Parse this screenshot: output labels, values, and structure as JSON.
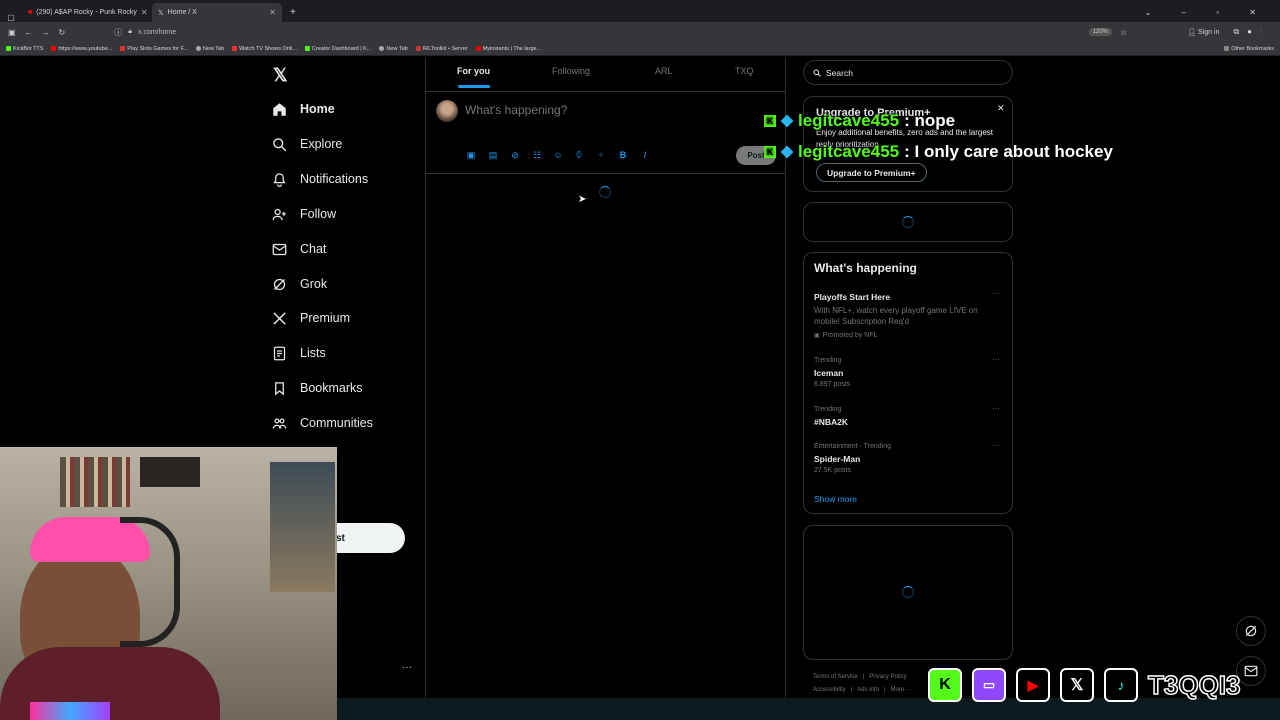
{
  "browser": {
    "tabs": [
      {
        "label": "(290) A$AP Rocky - Punk Rocky"
      },
      {
        "label": "Home / X"
      }
    ],
    "url": "x.com/home",
    "zoom": "120%",
    "sign_in": "Sign in",
    "bookmarks": [
      "KickBot TTS",
      "https://www.youtube...",
      "Play Slots Games for F...",
      "New Tab",
      "Watch TV Shows Onli...",
      "Creator Dashboard | K...",
      "New Tab",
      "IRLToolkit • Server",
      "Myinstants | The large..."
    ],
    "other_bookmarks": "Other Bookmarks"
  },
  "nav": {
    "items": [
      {
        "label": "Home",
        "icon": "home-icon"
      },
      {
        "label": "Explore",
        "icon": "search-icon"
      },
      {
        "label": "Notifications",
        "icon": "bell-icon"
      },
      {
        "label": "Follow",
        "icon": "follow-icon"
      },
      {
        "label": "Chat",
        "icon": "mail-icon"
      },
      {
        "label": "Grok",
        "icon": "grok-icon"
      },
      {
        "label": "Premium",
        "icon": "x-logo-icon"
      },
      {
        "label": "Lists",
        "icon": "list-icon"
      },
      {
        "label": "Bookmarks",
        "icon": "bookmark-icon"
      },
      {
        "label": "Communities",
        "icon": "communities-icon"
      }
    ],
    "post_button_partial": "st",
    "more_dots": "···"
  },
  "feed": {
    "tabs": [
      "For you",
      "Following",
      "ARL",
      "TXQ"
    ],
    "composer_placeholder": "What's happening?",
    "post_button": "Post"
  },
  "right": {
    "search_placeholder": "Search",
    "premium": {
      "title": "Upgrade to Premium+",
      "text": "Enjoy additional benefits, zero ads and the largest reply prioritization.",
      "button": "Upgrade to Premium+"
    },
    "happening": {
      "title": "What's happening",
      "items": [
        {
          "meta": "",
          "title": "Playoffs Start Here",
          "desc": "With NFL+, watch every playoff game LIVE on mobile! Subscription Req'd",
          "promo": "Promoted by NFL"
        },
        {
          "meta": "Trending",
          "title": "Iceman",
          "count": "6,897 posts"
        },
        {
          "meta": "Trending",
          "title": "#NBA2K",
          "count": ""
        },
        {
          "meta": "Entertainment · Trending",
          "title": "Spider-Man",
          "count": "27.5K posts"
        }
      ],
      "show_more": "Show more"
    },
    "footer": [
      "Terms of Service",
      "|",
      "Privacy Policy",
      "Accessibility",
      "|",
      "Ads info",
      "|",
      "More ···"
    ]
  },
  "overlay": {
    "chat": [
      {
        "user": "legitcave455",
        "msg": " : nope"
      },
      {
        "user": "legitcave455",
        "msg": " : I only care about hockey"
      }
    ],
    "handle": "T3QQI3"
  },
  "colors": {
    "accent": "#1d9bf0",
    "kick": "#53fc18",
    "bg": "#000000"
  }
}
